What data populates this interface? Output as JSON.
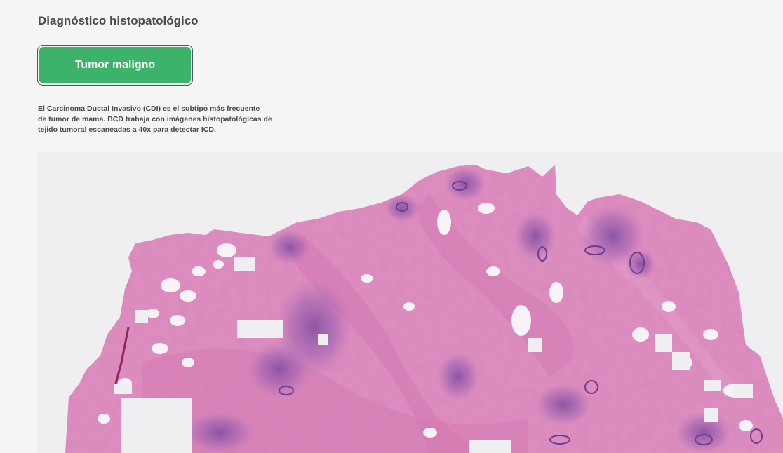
{
  "header": {
    "title": "Diagnóstico histopatológico"
  },
  "result": {
    "label": "Tumor maligno",
    "color": "#3cb36b"
  },
  "description": {
    "line1": "El Carcinoma Ductal Invasivo (CDI) es el subtipo más frecuente",
    "line2": "de tumor de mama. BCD trabaja con imágenes histopatológicas de",
    "line3": "tejido tumoral escaneadas a 40x para detectar ICD."
  },
  "slide": {
    "tissue_color": "#e08fc0",
    "stroma_color": "#d97bb3",
    "nuclei_color": "#7a4a9a",
    "background_color": "#efeff1"
  }
}
